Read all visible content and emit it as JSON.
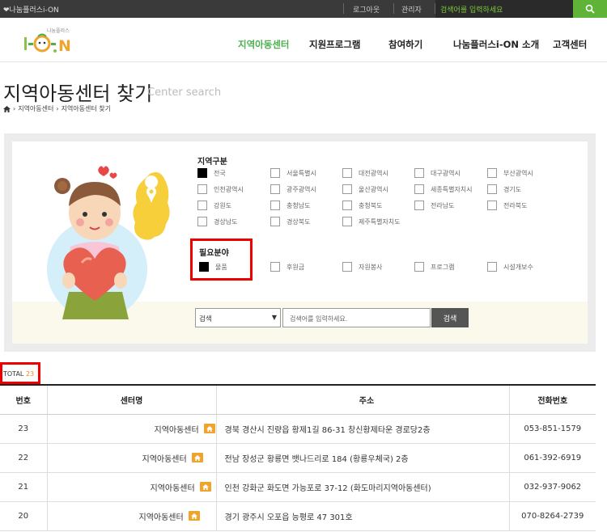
{
  "topbar": {
    "brand": "❤나눔플러스i-ON",
    "login": "로그아웃",
    "admin": "관리자",
    "search_placeholder": "검색어를 입력하세요"
  },
  "nav": [
    "지역아동센터",
    "지원프로그램",
    "참여하기",
    "나눔플러스i-ON 소개",
    "고객센터"
  ],
  "logo": {
    "small_text": "나눔플러스",
    "colors": {
      "accent": "#4caf50",
      "orange": "#f08a16"
    }
  },
  "page": {
    "title": "지역아동센터 찾기",
    "title_en": "Center search"
  },
  "breadcrumb": {
    "home": "home-icon",
    "items": [
      "지역아동센터",
      "지역아동센터 찾기"
    ]
  },
  "filters": {
    "region": {
      "title": "지역구분",
      "options": [
        {
          "label": "전국",
          "checked": true
        },
        {
          "label": "서울특별시",
          "checked": false
        },
        {
          "label": "대전광역시",
          "checked": false
        },
        {
          "label": "대구광역시",
          "checked": false
        },
        {
          "label": "부산광역시",
          "checked": false
        },
        {
          "label": "인천광역시",
          "checked": false
        },
        {
          "label": "광주광역시",
          "checked": false
        },
        {
          "label": "울산광역시",
          "checked": false
        },
        {
          "label": "세종특별자치시",
          "checked": false
        },
        {
          "label": "경기도",
          "checked": false
        },
        {
          "label": "강원도",
          "checked": false
        },
        {
          "label": "충청남도",
          "checked": false
        },
        {
          "label": "충청북도",
          "checked": false
        },
        {
          "label": "전라남도",
          "checked": false
        },
        {
          "label": "전라북도",
          "checked": false
        },
        {
          "label": "경상남도",
          "checked": false
        },
        {
          "label": "경상북도",
          "checked": false
        },
        {
          "label": "제주특별자치도",
          "checked": false
        }
      ]
    },
    "field": {
      "title": "필요분야",
      "options": [
        {
          "label": "물품",
          "checked": true
        },
        {
          "label": "후원금",
          "checked": false
        },
        {
          "label": "자원봉사",
          "checked": false
        },
        {
          "label": "프로그램",
          "checked": false
        },
        {
          "label": "시설개보수",
          "checked": false
        }
      ]
    },
    "search": {
      "select_value": "검색",
      "placeholder": "검색어를 입력하세요.",
      "button": "검색"
    }
  },
  "total": {
    "label": "TOTAL",
    "count": "23"
  },
  "table": {
    "headers": [
      "번호",
      "센터명",
      "주소",
      "전화번호"
    ],
    "rows": [
      {
        "no": "23",
        "name": "지역아동센터",
        "address": "경북 경산시 진량읍 황제1길 86-31 창신황제타운 경로당2층",
        "tel": "053-851-1579"
      },
      {
        "no": "22",
        "name": "지역아동센터",
        "address": "전남 장성군 황룡면 뱃나드리로 184 (황룡우체국) 2층",
        "tel": "061-392-6919"
      },
      {
        "no": "21",
        "name": "지역아동센터",
        "address": "인천 강화군 화도면 가능포로 37-12 (화도마리지역아동센터)",
        "tel": "032-937-9062"
      },
      {
        "no": "20",
        "name": "지역아동센터",
        "address": "경기 광주시 오포읍 능평로 47 301호",
        "tel": "070-8264-2739"
      }
    ]
  }
}
